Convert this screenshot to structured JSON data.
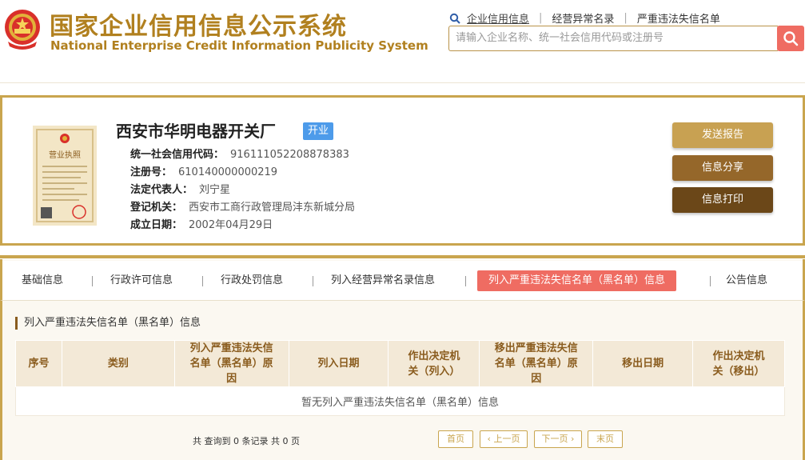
{
  "header": {
    "title_cn": "国家企业信用信息公示系统",
    "title_en": "National Enterprise Credit Information Publicity System",
    "links": [
      "企业信用信息",
      "经营异常名录",
      "严重违法失信名单"
    ],
    "search_placeholder": "请输入企业名称、统一社会信用代码或注册号",
    "search_icon": "search-icon"
  },
  "company": {
    "name": "西安市华明电器开关厂",
    "status": "开业",
    "license_text": "营业执照",
    "fields": [
      {
        "label": "统一社会信用代码：",
        "value": "916111052208878383"
      },
      {
        "label": "注册号：",
        "value": "610140000000219"
      },
      {
        "label": "法定代表人：",
        "value": "刘宁星"
      },
      {
        "label": "登记机关：",
        "value": "西安市工商行政管理局沣东新城分局"
      },
      {
        "label": "成立日期：",
        "value": "2002年04月29日"
      }
    ],
    "actions": [
      "发送报告",
      "信息分享",
      "信息打印"
    ]
  },
  "tabs": [
    "基础信息",
    "行政许可信息",
    "行政处罚信息",
    "列入经营异常名录信息",
    "列入严重违法失信名单（黑名单）信息",
    "公告信息"
  ],
  "active_tab": 4,
  "section_title": "列入严重违法失信名单（黑名单）信息",
  "table": {
    "headers": [
      "序号",
      "类别",
      "列入严重违法失信名单（黑名单）原因",
      "列入日期",
      "作出决定机关（列入）",
      "移出严重违法失信名单（黑名单）原因",
      "移出日期",
      "作出决定机关（移出）"
    ],
    "empty_text": "暂无列入严重违法失信名单（黑名单）信息"
  },
  "pager": {
    "info": "共 查询到 0 条记录 共 0 页",
    "first": "首页",
    "prev": "上一页",
    "next": "下一页",
    "last": "末页"
  },
  "colors": {
    "gold": "#c9a54e",
    "brand_text": "#b1801f",
    "active_tab": "#ef6c62",
    "status_badge": "#4d9bea",
    "btn_report": "#c8a152",
    "btn_share": "#95672a",
    "btn_print": "#6b4718"
  }
}
